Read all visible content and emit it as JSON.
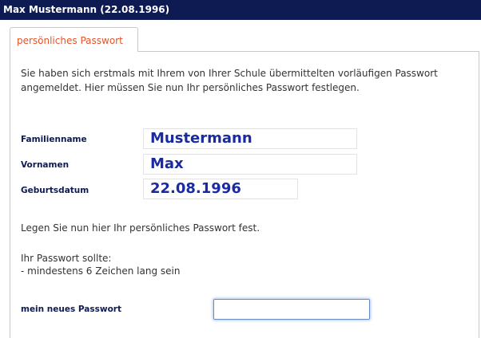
{
  "header": {
    "title": "Max Mustermann (22.08.1996)"
  },
  "tabs": [
    {
      "label": "persönliches Passwort",
      "active": true
    }
  ],
  "intro_text": "Sie haben sich erstmals mit Ihrem von Ihrer Schule übermittelten vorläufigen Passwort angemeldet. Hier müssen Sie nun Ihr persönliches Passwort festlegen.",
  "fields": {
    "familienname": {
      "label": "Familienname",
      "value": "Mustermann"
    },
    "vornamen": {
      "label": "Vornamen",
      "value": "Max"
    },
    "geburtsdatum": {
      "label": "Geburtsdatum",
      "value": "22.08.1996"
    }
  },
  "instructions": {
    "set_password": "Legen Sie nun hier Ihr persönliches Passwort fest.",
    "requirements_heading": "Ihr Passwort sollte:",
    "requirements": [
      "- mindestens 6 Zeichen lang sein"
    ]
  },
  "new_password": {
    "label": "mein neues Passwort",
    "value": ""
  },
  "colors": {
    "header_bg": "#0e1a52",
    "tab_text": "#e2552a",
    "label_text": "#0e1a52",
    "value_text": "#1a2aa0"
  }
}
